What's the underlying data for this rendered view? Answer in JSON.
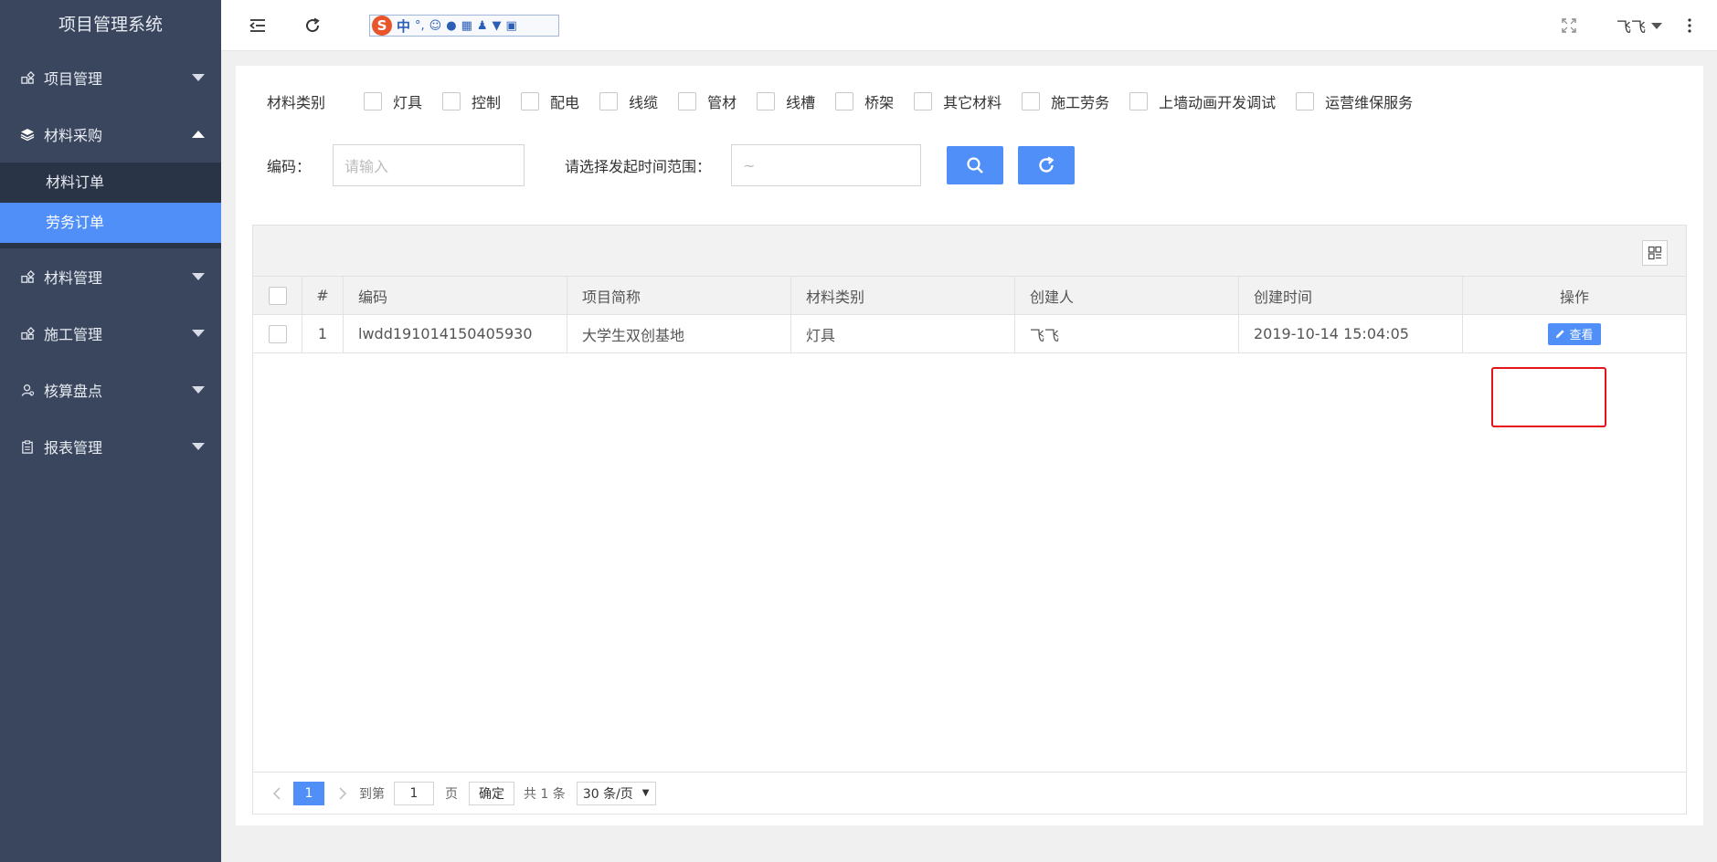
{
  "app": {
    "title": "项目管理系统"
  },
  "sidebar": {
    "items": [
      {
        "label": "项目管理",
        "icon": "project-icon",
        "expanded": false
      },
      {
        "label": "材料采购",
        "icon": "layers-icon",
        "expanded": true,
        "children": [
          {
            "label": "材料订单",
            "active": false
          },
          {
            "label": "劳务订单",
            "active": true
          }
        ]
      },
      {
        "label": "材料管理",
        "icon": "material-icon",
        "expanded": false
      },
      {
        "label": "施工管理",
        "icon": "construction-icon",
        "expanded": false
      },
      {
        "label": "核算盘点",
        "icon": "user-icon",
        "expanded": false
      },
      {
        "label": "报表管理",
        "icon": "report-icon",
        "expanded": false
      }
    ]
  },
  "topbar": {
    "ime": {
      "logo": "S",
      "mode": "中",
      "punct": "°,"
    },
    "user": {
      "name": "飞飞"
    }
  },
  "filter": {
    "category_label": "材料类别",
    "categories": [
      "灯具",
      "控制",
      "配电",
      "线缆",
      "管材",
      "线槽",
      "桥架",
      "其它材料",
      "施工劳务",
      "上墙动画开发调试",
      "运营维保服务"
    ]
  },
  "search": {
    "code_label": "编码：",
    "code_placeholder": "请输入",
    "time_label": "请选择发起时间范围：",
    "time_value": "~"
  },
  "table": {
    "headers": {
      "index": "#",
      "code": "编码",
      "project": "项目简称",
      "type": "材料类别",
      "creator": "创建人",
      "time": "创建时间",
      "op": "操作"
    },
    "rows": [
      {
        "index": "1",
        "code": "lwdd191014150405930",
        "project": "大学生双创基地",
        "type": "灯具",
        "creator": "飞飞",
        "time": "2019-10-14 15:04:05",
        "action": "查看"
      }
    ]
  },
  "pager": {
    "current": "1",
    "goto_label": "到第",
    "goto_value": "1",
    "page_label": "页",
    "confirm": "确定",
    "total": "共 1 条",
    "size": "30 条/页"
  },
  "colors": {
    "sidebar": "#39465d",
    "submenu": "#2a3447",
    "accent": "#4f8ff7",
    "highlight": "#e5141a"
  }
}
